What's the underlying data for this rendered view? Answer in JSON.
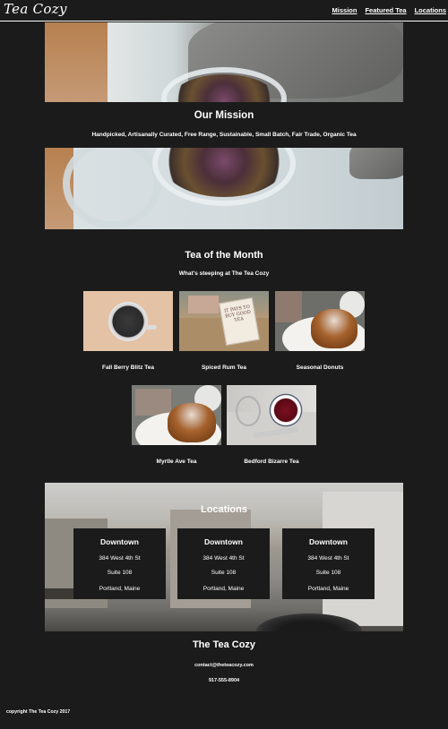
{
  "header": {
    "logo": "Tea Cozy",
    "nav": [
      "Mission",
      "Featured Tea",
      "Locations"
    ]
  },
  "mission": {
    "title": "Our Mission",
    "text": "Handpicked, Artisanally Curated, Free Range, Sustainable, Small Batch, Fair Trade, Organic Tea"
  },
  "tea_of_month": {
    "title": "Tea of the Month",
    "subtitle": "What's steeping at The Tea Cozy",
    "items": [
      {
        "label": "Fall Berry Blitz Tea"
      },
      {
        "label": "Spiced Rum Tea"
      },
      {
        "label": "Seasonal Donuts"
      },
      {
        "label": "Myrtle Ave Tea"
      },
      {
        "label": "Bedford Bizarre Tea"
      }
    ],
    "box_text": "IT PAYS TO BUY GOOD TEA"
  },
  "locations": {
    "title": "Locations",
    "cards": [
      {
        "name": "Downtown",
        "street": "384 West 4th St",
        "suite": "Suite 108",
        "city": "Portland, Maine"
      },
      {
        "name": "Downtown",
        "street": "384 West 4th St",
        "suite": "Suite 108",
        "city": "Portland, Maine"
      },
      {
        "name": "Downtown",
        "street": "384 West 4th St",
        "suite": "Suite 108",
        "city": "Portland, Maine"
      }
    ]
  },
  "footer": {
    "title": "The Tea Cozy",
    "email": "contact@theteacozy.com",
    "phone": "917-555-8904",
    "copyright": "copyright The Tea Cozy 2017"
  },
  "colors": {
    "background": "#1b1b1b",
    "text": "#ffffff"
  }
}
